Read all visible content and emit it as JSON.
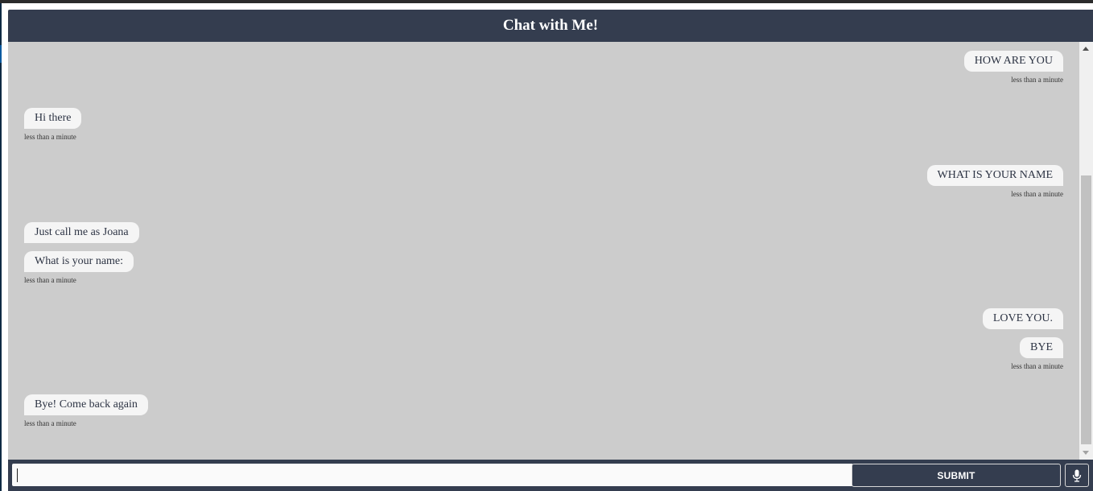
{
  "header": {
    "title": "Chat with Me!"
  },
  "messages": [
    {
      "sender": "user",
      "text": "HOW ARE YOU"
    },
    {
      "sender": "bot",
      "text": "Hi there"
    },
    {
      "sender": "user",
      "text": "WHAT IS YOUR NAME"
    },
    {
      "sender": "bot",
      "text": "Just call me as Joana"
    },
    {
      "sender": "bot",
      "text": "What is your name:"
    },
    {
      "sender": "user",
      "text": "LOVE YOU."
    },
    {
      "sender": "user",
      "text": "BYE"
    },
    {
      "sender": "bot",
      "text": "Bye! Come back again"
    }
  ],
  "timestamps": [
    {
      "sender": "user",
      "text": "less than a minute"
    },
    {
      "sender": "bot",
      "text": "less than a minute"
    },
    {
      "sender": "user",
      "text": "less than a minute"
    },
    {
      "sender": "bot",
      "text": "less than a minute"
    },
    {
      "sender": "user",
      "text": "less than a minute"
    },
    {
      "sender": "bot",
      "text": "less than a minute"
    }
  ],
  "input": {
    "value": "",
    "placeholder": ""
  },
  "buttons": {
    "submit_label": "SUBMIT",
    "mic_icon": "microphone-icon"
  },
  "colors": {
    "header_bg": "#343d4f",
    "messages_bg": "#cccccc",
    "bubble_bg": "#f5f5f5"
  }
}
